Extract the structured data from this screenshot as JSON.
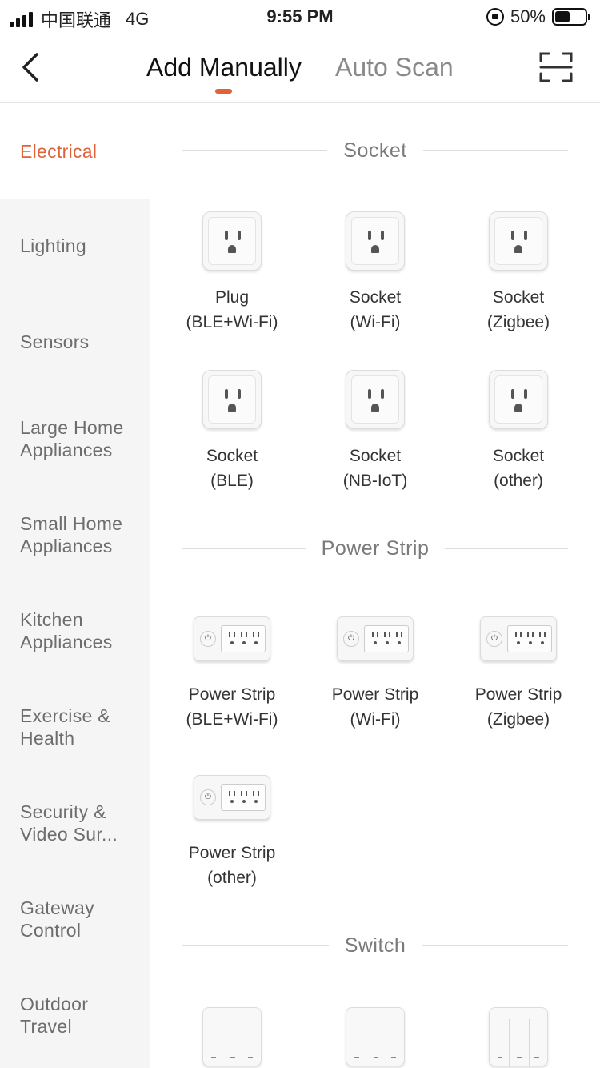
{
  "status_bar": {
    "carrier": "中国联通",
    "network": "4G",
    "time": "9:55 PM",
    "battery": "50%",
    "battery_level": 0.5
  },
  "nav": {
    "tabs": [
      {
        "label": "Add Manually",
        "active": true
      },
      {
        "label": "Auto Scan",
        "active": false
      }
    ],
    "accent_color": "#e0623a"
  },
  "sidebar": {
    "items": [
      {
        "label": "Electrical",
        "active": true
      },
      {
        "label": "Lighting"
      },
      {
        "label": "Sensors"
      },
      {
        "label": "Large Home Appliances"
      },
      {
        "label": "Small Home Appliances"
      },
      {
        "label": "Kitchen Appliances"
      },
      {
        "label": "Exercise & Health"
      },
      {
        "label": "Security & Video Sur..."
      },
      {
        "label": "Gateway Control"
      },
      {
        "label": "Outdoor Travel"
      }
    ]
  },
  "sections": [
    {
      "title": "Socket",
      "devices": [
        {
          "line1": "Plug",
          "line2": "(BLE+Wi-Fi)",
          "icon": "socket-icon"
        },
        {
          "line1": "Socket",
          "line2": "(Wi-Fi)",
          "icon": "socket-icon"
        },
        {
          "line1": "Socket",
          "line2": "(Zigbee)",
          "icon": "socket-icon"
        },
        {
          "line1": "Socket",
          "line2": "(BLE)",
          "icon": "socket-icon"
        },
        {
          "line1": "Socket",
          "line2": "(NB-IoT)",
          "icon": "socket-icon"
        },
        {
          "line1": "Socket",
          "line2": "(other)",
          "icon": "socket-icon"
        }
      ]
    },
    {
      "title": "Power Strip",
      "devices": [
        {
          "line1": "Power Strip",
          "line2": "(BLE+Wi-Fi)",
          "icon": "power-strip-icon"
        },
        {
          "line1": "Power Strip",
          "line2": "(Wi-Fi)",
          "icon": "power-strip-icon"
        },
        {
          "line1": "Power Strip",
          "line2": "(Zigbee)",
          "icon": "power-strip-icon"
        },
        {
          "line1": "Power Strip",
          "line2": "(other)",
          "icon": "power-strip-icon"
        }
      ]
    },
    {
      "title": "Switch",
      "devices": [
        {
          "icon": "switch-1-gang-icon"
        },
        {
          "icon": "switch-2-gang-icon"
        },
        {
          "icon": "switch-3-gang-icon"
        }
      ]
    }
  ]
}
